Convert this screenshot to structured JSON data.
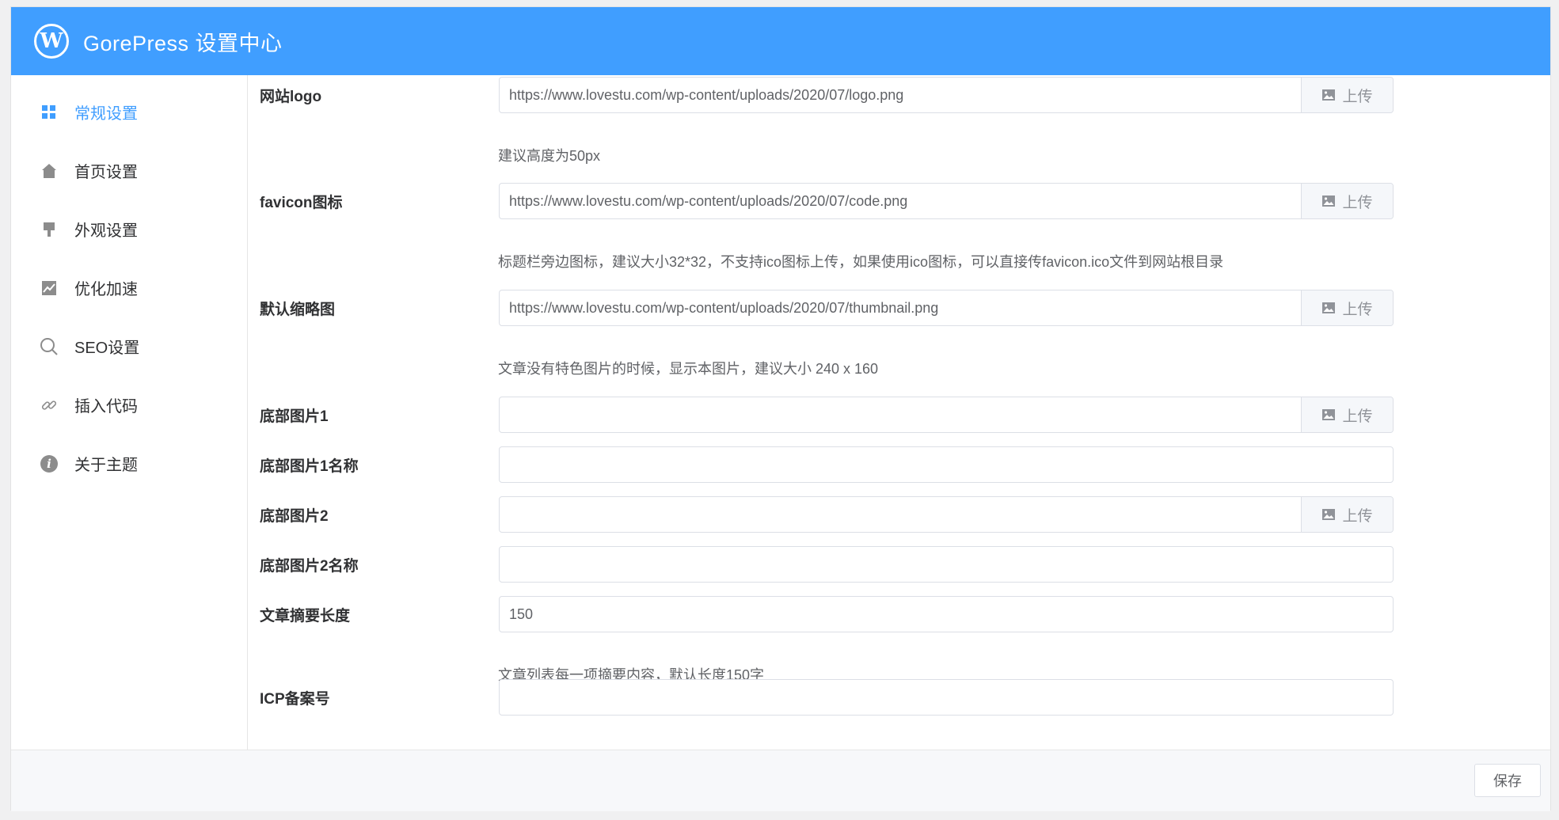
{
  "header": {
    "logo_icon": "wordpress-logo-icon",
    "title": "GorePress 设置中心"
  },
  "sidebar": {
    "items": [
      {
        "label": "常规设置",
        "icon": "grid-icon",
        "active": true
      },
      {
        "label": "首页设置",
        "icon": "home-icon"
      },
      {
        "label": "外观设置",
        "icon": "paint-brush-icon"
      },
      {
        "label": "优化加速",
        "icon": "chart-icon"
      },
      {
        "label": "SEO设置",
        "icon": "search-icon"
      },
      {
        "label": "插入代码",
        "icon": "link-icon"
      },
      {
        "label": "关于主题",
        "icon": "info-icon"
      }
    ]
  },
  "form": {
    "upload_label": "上传",
    "logo": {
      "label": "网站logo",
      "value": "https://www.lovestu.com/wp-content/uploads/2020/07/logo.png",
      "hint": "建议高度为50px"
    },
    "favicon": {
      "label": "favicon图标",
      "value": "https://www.lovestu.com/wp-content/uploads/2020/07/code.png",
      "hint": "标题栏旁边图标，建议大小32*32，不支持ico图标上传，如果使用ico图标，可以直接传favicon.ico文件到网站根目录"
    },
    "thumbnail": {
      "label": "默认缩略图",
      "value": "https://www.lovestu.com/wp-content/uploads/2020/07/thumbnail.png",
      "hint": "文章没有特色图片的时候，显示本图片，建议大小 240 x 160"
    },
    "footer_img1": {
      "label": "底部图片1",
      "value": ""
    },
    "footer_img1_name": {
      "label": "底部图片1名称",
      "value": ""
    },
    "footer_img2": {
      "label": "底部图片2",
      "value": ""
    },
    "footer_img2_name": {
      "label": "底部图片2名称",
      "value": ""
    },
    "excerpt_length": {
      "label": "文章摘要长度",
      "value": "150",
      "hint": "文章列表每一项摘要内容，默认长度150字"
    },
    "icp": {
      "label": "ICP备案号",
      "value": ""
    }
  },
  "footer": {
    "save_label": "保存"
  },
  "colors": {
    "accent": "#409eff",
    "icon_gray": "#8c8c8c"
  }
}
